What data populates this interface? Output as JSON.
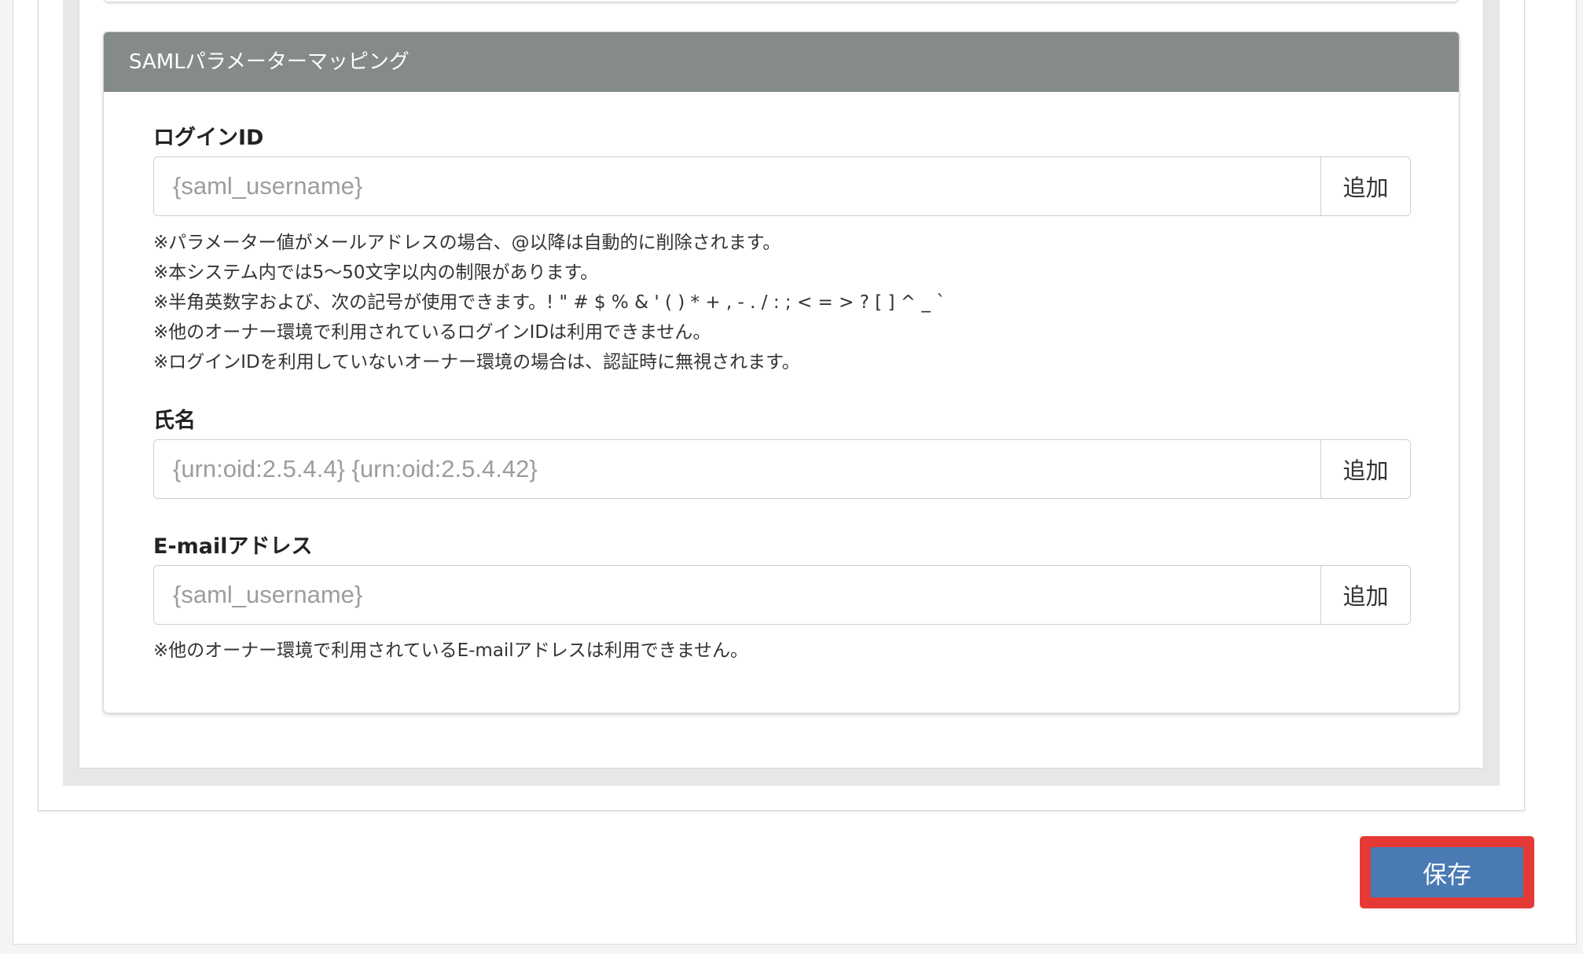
{
  "card": {
    "header_title": "SAMLパラメーターマッピング"
  },
  "fields": {
    "login_id": {
      "label": "ログインID",
      "placeholder": "{saml_username}",
      "add_label": "追加",
      "notes": [
        "※パラメーター値がメールアドレスの場合、@以降は自動的に削除されます。",
        "※本システム内では5〜50文字以内の制限があります。",
        "※半角英数字および、次の記号が使用できます。! \" # $ % & ' ( ) * + , - . / : ; < = > ? [ ] ^ _ `",
        "※他のオーナー環境で利用されているログインIDは利用できません。",
        "※ログインIDを利用していないオーナー環境の場合は、認証時に無視されます。"
      ]
    },
    "name": {
      "label": "氏名",
      "placeholder": "{urn:oid:2.5.4.4} {urn:oid:2.5.4.42}",
      "add_label": "追加"
    },
    "email": {
      "label": "E-mailアドレス",
      "placeholder": "{saml_username}",
      "add_label": "追加",
      "notes": [
        "※他のオーナー環境で利用されているE-mailアドレスは利用できません。"
      ]
    }
  },
  "footer": {
    "save_label": "保存"
  },
  "colors": {
    "header_bg": "#858b8b",
    "save_button": "#4a7ab4",
    "highlight": "#e53935"
  }
}
